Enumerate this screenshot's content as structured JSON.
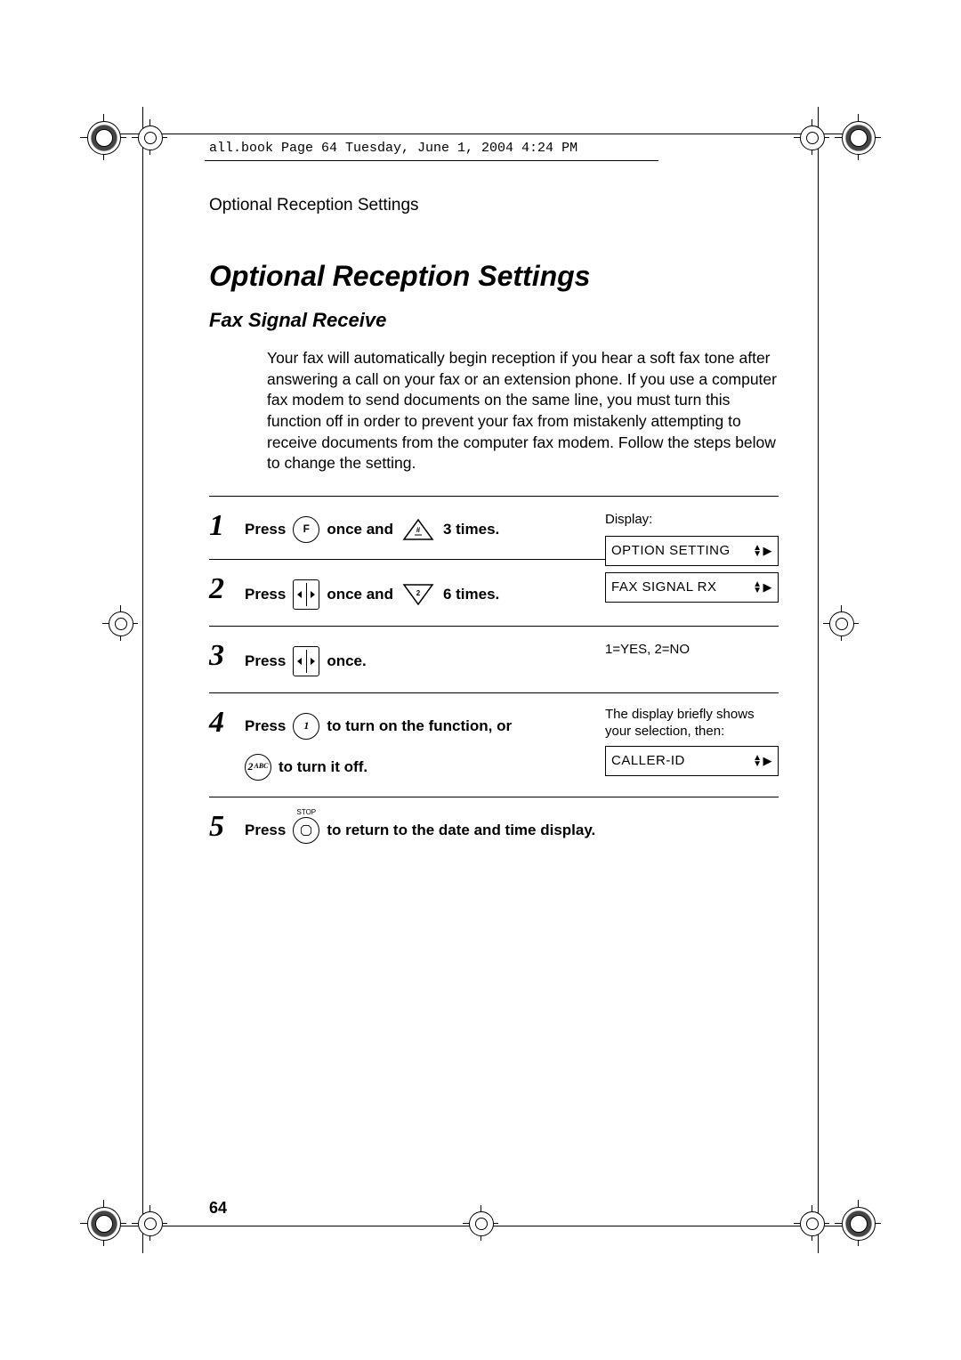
{
  "meta_header": "all.book  Page 64  Tuesday, June 1, 2004  4:24 PM",
  "running_head": "Optional Reception Settings",
  "title": "Optional Reception Settings",
  "subtitle": "Fax Signal Receive",
  "intro": "Your fax will automatically begin reception if you hear a soft fax tone after answering a call on your fax or an extension phone. If you use a computer fax modem to send documents on the same line, you must turn this function off in order to prevent your fax from mistakenly attempting to receive documents from the computer fax modem. Follow the steps below to change the setting.",
  "display_label": "Display:",
  "steps": [
    {
      "num": "1",
      "parts": {
        "press": "Press",
        "key_f": "F",
        "once_and": "once and",
        "tri_label": "#",
        "times": "3 times."
      },
      "lcd": "OPTION SETTING",
      "lcd_arrows": "udr"
    },
    {
      "num": "2",
      "parts": {
        "press": "Press",
        "once_and": "once and",
        "tri_label": "2",
        "times": "6 times."
      },
      "lcd": "FAX SIGNAL RX",
      "lcd_arrows": "udr"
    },
    {
      "num": "3",
      "parts": {
        "press": "Press",
        "once": "once."
      },
      "display_text": "1=YES, 2=NO"
    },
    {
      "num": "4",
      "parts": {
        "press": "Press",
        "key_1": "1",
        "turn_on": "to turn on the function, or",
        "key_2": "2",
        "key_2_sub": "ABC",
        "turn_off": "to turn it off."
      },
      "display_note": "The display briefly shows your selection, then:",
      "lcd": "CALLER-ID",
      "lcd_arrows": "udr"
    },
    {
      "num": "5",
      "parts": {
        "press": "Press",
        "stop_label": "STOP",
        "tail": "to return to the date and time display."
      }
    }
  ],
  "page_number": "64"
}
